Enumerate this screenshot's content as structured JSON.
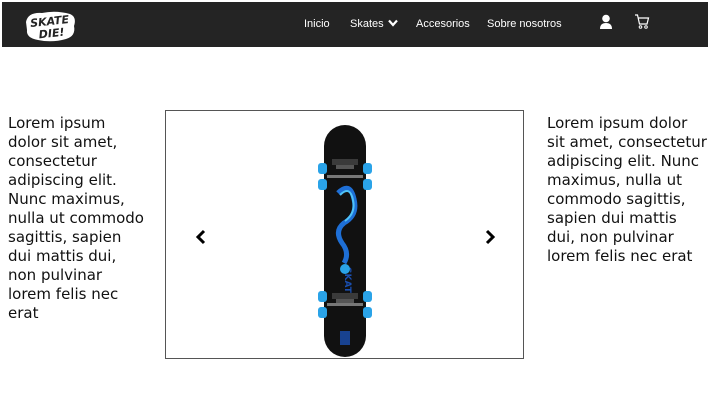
{
  "brand": {
    "logo_text_line1": "SKATE",
    "logo_text_line2": "DIE!",
    "logo_icon": "skate-or-die-logo"
  },
  "nav": {
    "items": [
      {
        "label": "Inicio"
      },
      {
        "label": "Skates",
        "icon": "chevron-down-icon"
      },
      {
        "label": "Accesorios"
      },
      {
        "label": "Sobre nosotros"
      }
    ],
    "user_icon": "user-icon",
    "cart_icon": "cart-icon"
  },
  "content": {
    "left_text": "Lorem ipsum dolor sit amet, consectetur adipiscing elit. Nunc maximus, nulla ut commodo sagittis, sapien dui mattis dui, non pulvinar lorem felis nec erat",
    "right_text": "Lorem ipsum dolor sit amet, consectetur adipiscing elit. Nunc maximus, nulla ut commodo sagittis, sapien dui mattis dui, non pulvinar lorem felis nec erat"
  },
  "carousel": {
    "prev_icon": "chevron-left-icon",
    "next_icon": "chevron-right-icon",
    "image": "skateboard-image"
  },
  "colors": {
    "navbar_bg": "#242424",
    "nav_text": "#ffffff",
    "deck_black": "#111111",
    "wheel_blue": "#2aa3e8",
    "graphic_blue": "#1e6fd6"
  }
}
